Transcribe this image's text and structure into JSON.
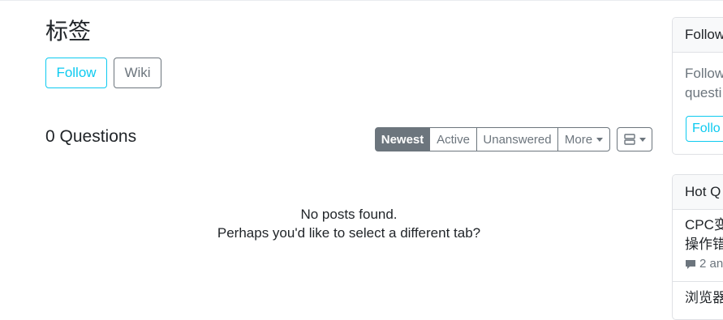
{
  "tag": {
    "title": "标签",
    "follow_label": "Follow",
    "wiki_label": "Wiki"
  },
  "questions": {
    "count_label": "0 Questions",
    "tabs": [
      {
        "label": "Newest",
        "active": true
      },
      {
        "label": "Active",
        "active": false
      },
      {
        "label": "Unanswered",
        "active": false
      },
      {
        "label": "More",
        "active": false
      }
    ],
    "empty_line1": "No posts found.",
    "empty_line2": "Perhaps you'd like to select a different tab?"
  },
  "sidebar": {
    "follow_card": {
      "header": "Follow",
      "body_line1": "Follow",
      "body_line2": "questi",
      "button_label": "Follo"
    },
    "hot_card": {
      "header": "Hot Q",
      "item1_line1": "CPC变",
      "item1_line2": "操作错",
      "item1_meta": "2 an",
      "item2_line1": "浏览器"
    }
  },
  "icons": {
    "view_toggle": "list-view-icon",
    "comment": "comment-icon"
  },
  "colors": {
    "info": "#0dcaf0",
    "secondary": "#6c757d"
  }
}
